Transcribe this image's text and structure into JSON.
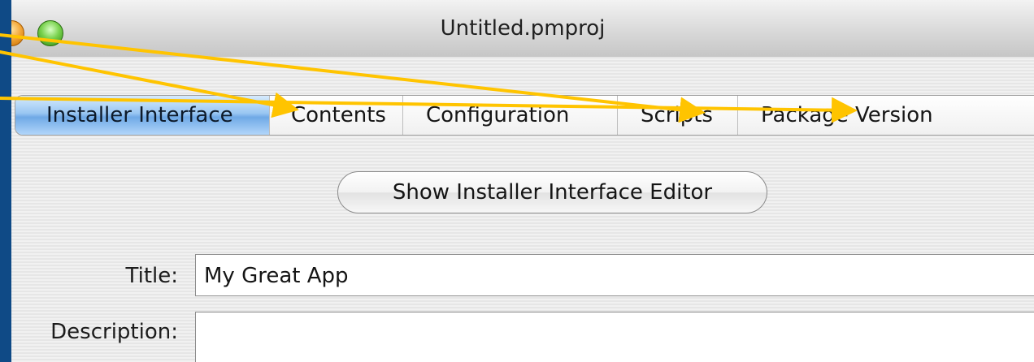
{
  "window": {
    "title": "Untitled.pmproj"
  },
  "tabs": [
    {
      "label": "Installer Interface",
      "active": true
    },
    {
      "label": "Contents"
    },
    {
      "label": "Configuration"
    },
    {
      "label": "Scripts"
    },
    {
      "label": "Package Version"
    }
  ],
  "buttons": {
    "show_editor": "Show Installer Interface Editor"
  },
  "form": {
    "title_label": "Title:",
    "title_value": "My Great App",
    "description_label": "Description:",
    "description_value": ""
  },
  "colors": {
    "desktop": "#0f4a86",
    "annotation_arrow": "#ffc400",
    "active_tab": "#6fa9e6"
  },
  "icons": [
    "close-button-icon",
    "zoom-button-icon",
    "annotation-arrow-icon"
  ]
}
